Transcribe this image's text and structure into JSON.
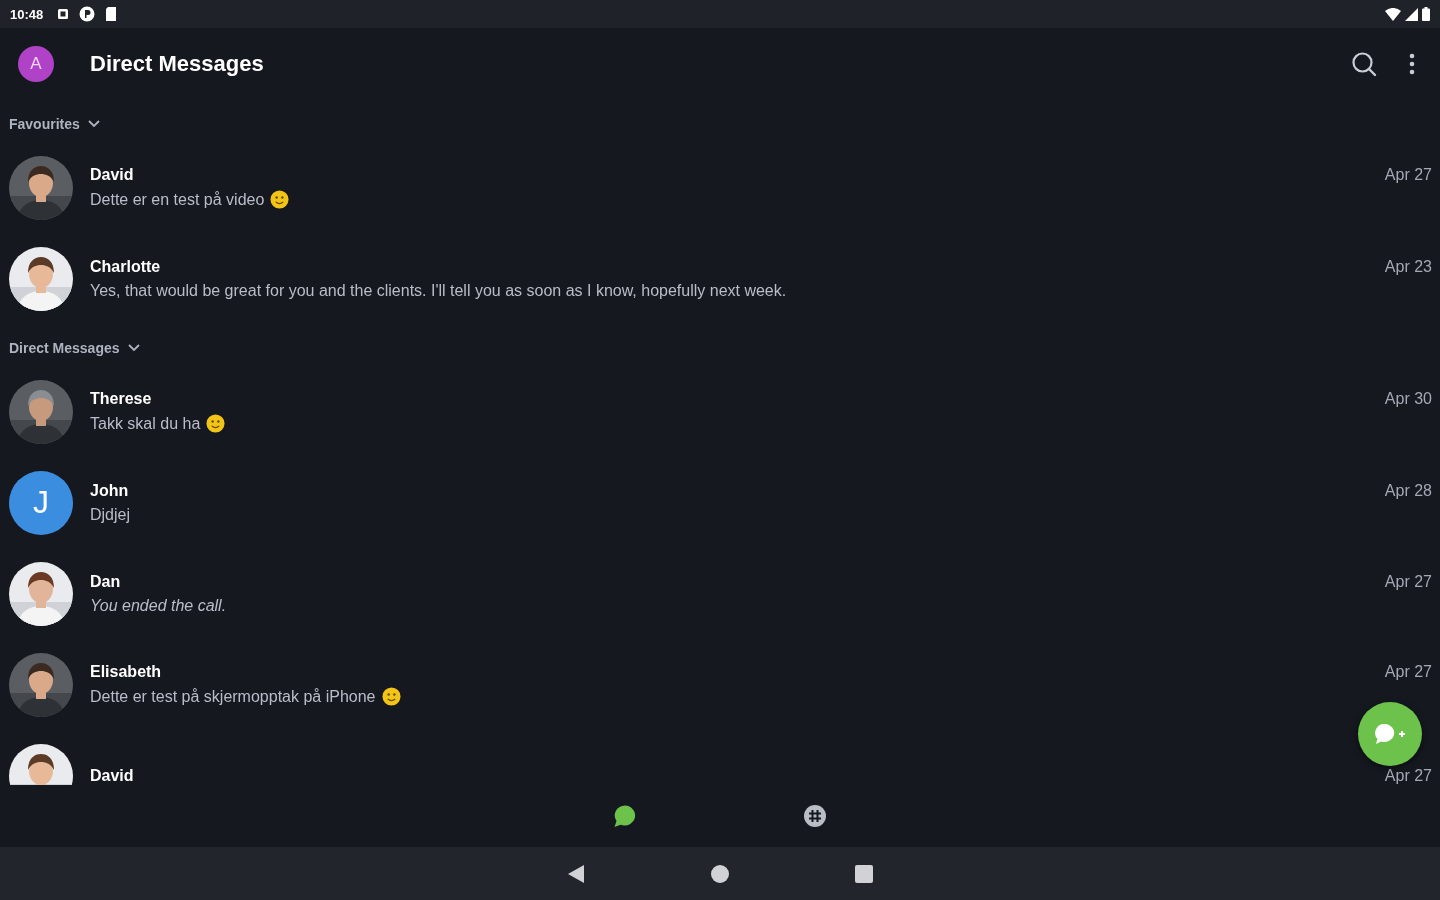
{
  "status_bar": {
    "time": "10:48"
  },
  "app_bar": {
    "avatar": {
      "letter": "A",
      "color": "#b042c8"
    },
    "title": "Direct Messages"
  },
  "sections": [
    {
      "title": "Favourites",
      "expanded": true,
      "conversations": [
        {
          "name": "David",
          "message": "Dette er en test på video",
          "emoji": true,
          "date": "Apr 27"
        },
        {
          "name": "Charlotte",
          "message": "Yes, that would be great for you and the clients. I'll tell you as soon as I know, hopefully next week.",
          "date": "Apr 23"
        }
      ]
    },
    {
      "title": "Direct Messages",
      "expanded": true,
      "conversations": [
        {
          "name": "Therese",
          "message": "Takk skal du ha",
          "emoji": true,
          "date": "Apr 30"
        },
        {
          "name": "John",
          "message": "Djdjej",
          "date": "Apr 28",
          "avatar": {
            "kind": "initial",
            "letter": "J",
            "color": "#3b8de0"
          }
        },
        {
          "name": "Dan",
          "message": "You ended the call.",
          "italic": true,
          "date": "Apr 27"
        },
        {
          "name": "Elisabeth",
          "message": "Dette er test på skjermopptak på iPhone",
          "emoji": true,
          "date": "Apr 27"
        },
        {
          "name": "David",
          "date": "Apr 27"
        }
      ]
    }
  ],
  "bottom_nav": [
    {
      "kind": "chats",
      "selected": true
    },
    {
      "kind": "channels",
      "selected": false
    }
  ]
}
